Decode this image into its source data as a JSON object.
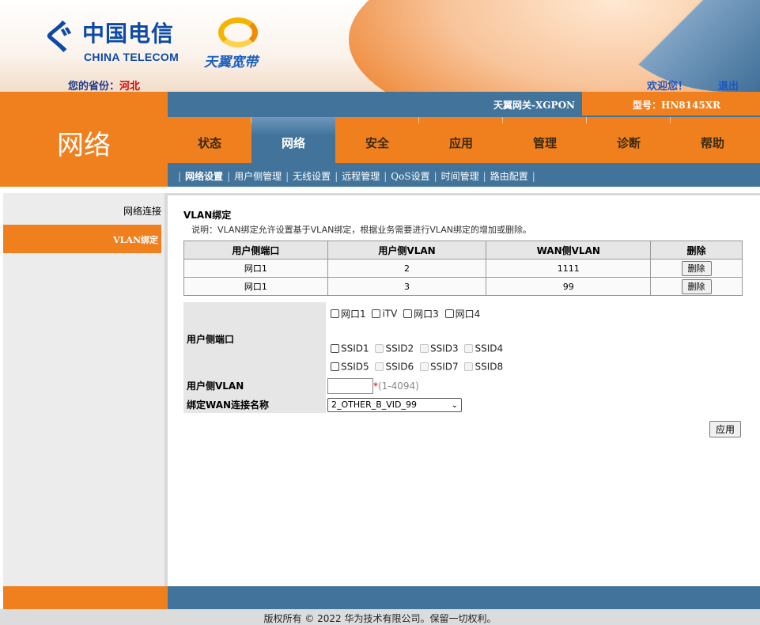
{
  "header": {
    "logo_zh": "中国电信",
    "logo_en": "CHINA TELECOM",
    "product_logo": "天翼宽带",
    "province_label": "您的省份：",
    "province_value": "河北",
    "welcome": "欢迎您！",
    "logout": "退出"
  },
  "section_title": "网络",
  "info_bar": {
    "gateway_name": "天翼网关-XGPON",
    "model": "型号：HN8145XR"
  },
  "main_nav": {
    "tabs": [
      {
        "label": "状态"
      },
      {
        "label": "网络"
      },
      {
        "label": "安全"
      },
      {
        "label": "应用"
      },
      {
        "label": "管理"
      },
      {
        "label": "诊断"
      },
      {
        "label": "帮助"
      }
    ],
    "active": "网络"
  },
  "sub_nav": {
    "items": [
      {
        "label": "网络设置"
      },
      {
        "label": "用户侧管理"
      },
      {
        "label": "无线设置"
      },
      {
        "label": "远程管理"
      },
      {
        "label": "QoS设置"
      },
      {
        "label": "时间管理"
      },
      {
        "label": "路由配置"
      }
    ],
    "active": "网络设置"
  },
  "sidebar": {
    "items": [
      {
        "label": "网络连接"
      },
      {
        "label": "VLAN绑定"
      }
    ],
    "active": "VLAN绑定"
  },
  "content": {
    "title": "VLAN绑定",
    "description": "说明：VLAN绑定允许设置基于VLAN绑定，根据业务需要进行VLAN绑定的增加或删除。",
    "table": {
      "headers": [
        "用户侧端口",
        "用户侧VLAN",
        "WAN侧VLAN",
        "删除"
      ],
      "rows": [
        {
          "port": "网口1",
          "user_vlan": "2",
          "wan_vlan": "1111",
          "action": "删除"
        },
        {
          "port": "网口1",
          "user_vlan": "3",
          "wan_vlan": "99",
          "action": "删除"
        }
      ]
    },
    "form": {
      "port_label": "用户侧端口",
      "ports_row1": [
        {
          "label": "网口1",
          "disabled": false
        },
        {
          "label": "iTV",
          "disabled": false
        },
        {
          "label": "网口3",
          "disabled": false
        },
        {
          "label": "网口4",
          "disabled": false
        }
      ],
      "ports_row2": [
        {
          "label": "SSID1",
          "disabled": false
        },
        {
          "label": "SSID2",
          "disabled": true
        },
        {
          "label": "SSID3",
          "disabled": true
        },
        {
          "label": "SSID4",
          "disabled": true
        }
      ],
      "ports_row3": [
        {
          "label": "SSID5",
          "disabled": false
        },
        {
          "label": "SSID6",
          "disabled": true
        },
        {
          "label": "SSID7",
          "disabled": true
        },
        {
          "label": "SSID8",
          "disabled": true
        }
      ],
      "vlan_label": "用户侧VLAN",
      "vlan_value": "",
      "vlan_required": "*",
      "vlan_hint": "(1-4094)",
      "wan_label": "绑定WAN连接名称",
      "wan_selected": "2_OTHER_B_VID_99",
      "apply_label": "应用"
    }
  },
  "footer": {
    "copyright": "版权所有 © 2022 华为技术有限公司。保留一切权利。"
  },
  "colors": {
    "orange": "#f0801e",
    "blue": "#41739b",
    "brand_blue": "#0c4aa6",
    "province_red": "#d80000"
  }
}
